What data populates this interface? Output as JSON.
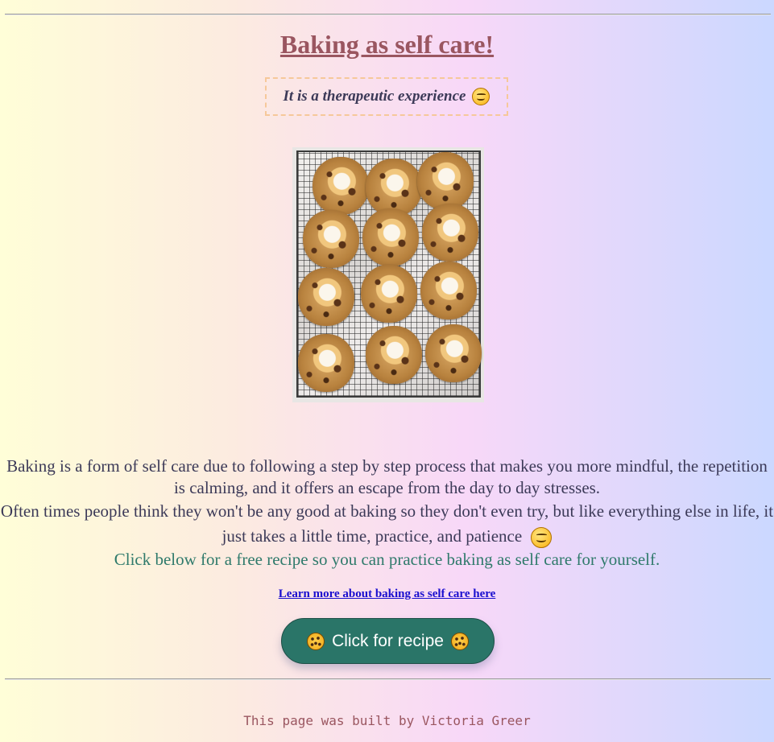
{
  "page": {
    "title": "Baking as self care!",
    "subtitle": "It is a therapeutic experience",
    "subtitle_icon": "smiling-face-icon"
  },
  "photo": {
    "subject": "cookies-on-cooling-rack",
    "cookie_count": 12
  },
  "body": {
    "line1": "Baking is a form of self care due to following a step by step process that makes you more mindful, the repetition is calming, and it offers an escape from the day to day stresses.",
    "line2": "Often times people think they won't be any good at baking so they don't even try, but like everything else in life, it just takes a little time, practice, and patience",
    "line2_icon": "smiling-face-icon",
    "line3": "Click below for a free recipe so you can practice baking as self care for yourself."
  },
  "link": {
    "label": "Learn more about baking as self care here"
  },
  "button": {
    "label": "Click for recipe",
    "icon": "cookie-icon"
  },
  "footer": {
    "text": "This page was built by Victoria Greer"
  },
  "colors": {
    "title": "#9a5660",
    "text": "#3c3a58",
    "accent_green": "#2f7a6b",
    "button_bg": "#2a7568",
    "link": "#1a0fcf",
    "subtitle_border": "#f6c89a"
  }
}
